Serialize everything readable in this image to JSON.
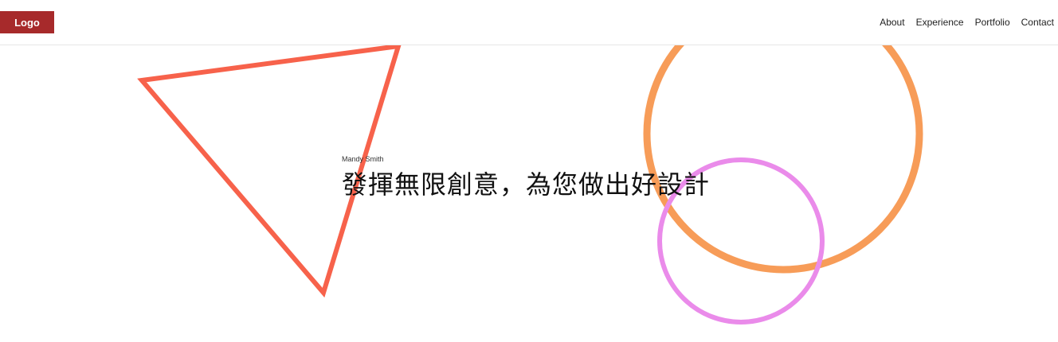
{
  "header": {
    "logo_label": "Logo",
    "nav": [
      {
        "label": "About"
      },
      {
        "label": "Experience"
      },
      {
        "label": "Portfolio"
      },
      {
        "label": "Contact"
      }
    ]
  },
  "hero": {
    "author": "Mandy Smith",
    "headline": "發揮無限創意，為您做出好設計"
  },
  "colors": {
    "logo_bg": "#a72a2b",
    "triangle_stroke": "#f7624b",
    "big_circle_stroke": "#f79c58",
    "small_circle_stroke": "#ea8bea"
  }
}
